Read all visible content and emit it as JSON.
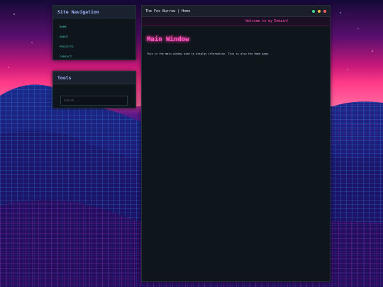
{
  "colors": {
    "accent_pink": "#ff4fb0",
    "nav_link": "#4fd8d0",
    "panel_title": "#a8b8ff",
    "panel_bg": "#0e151b",
    "dot_green": "#40d99a",
    "dot_yellow": "#f0c040",
    "dot_red": "#ff5a6a"
  },
  "nav": {
    "title": "Site Navigation",
    "items": [
      {
        "label": "HOME"
      },
      {
        "label": "ABOUT"
      },
      {
        "label": "PROJECTS"
      },
      {
        "label": "CONTACT"
      }
    ]
  },
  "tools": {
    "title": "Tools",
    "search_placeholder": "Search..."
  },
  "window": {
    "title": "The Fox Burrow | Home",
    "banner": "Welcome to my Domain!",
    "heading": "Main Window",
    "text": "This is the main window used to display information. This is also the Home page."
  },
  "icons": [
    "window-control-green-dot",
    "window-control-yellow-dot",
    "window-control-red-dot"
  ]
}
